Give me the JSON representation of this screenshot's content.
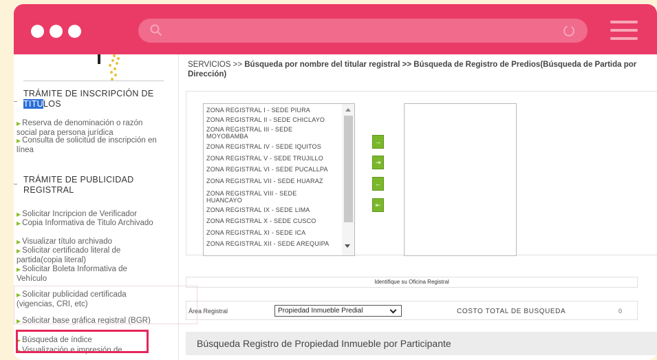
{
  "sidebar": {
    "section1_title_a": "TRÁMITE DE INSCRIPCIÓN DE",
    "section1_title_highlight": "TITU",
    "section1_title_rest": "LOS",
    "section1_links": [
      "Reserva de denominación o razón social para persona jurídica",
      "Consulta de solicitud de inscripción en línea"
    ],
    "section2_title": "TRÁMITE DE PUBLICIDAD REGISTRAL",
    "section2_links": [
      "Solicitar Incripcion de Verificador",
      "Copia Informativa de Titulo Archivado",
      "Visualizar título archivado",
      "Solicitar certificado literal de partida(copia literal)",
      "Solicitar Boleta Informativa de Vehículo",
      "Solicitar publicidad certificada (vigencias, CRI, etc)",
      "Solicitar base gráfica registral (BGR)",
      "Búsqueda de índice",
      "Visualización e impresión de"
    ]
  },
  "breadcrumb": {
    "prefix": "SERVICIOS >> ",
    "bold": "Búsqueda por nombre del titular registral >> Búsqueda de Registro de Predios(Búsqueda de Partida por Dirección)"
  },
  "zones": [
    "ZONA REGISTRAL I - SEDE PIURA",
    "ZONA REGISTRAL II - SEDE CHICLAYO",
    "ZONA REGISTRAL III - SEDE MOYOBAMBA",
    "ZONA REGISTRAL IV - SEDE IQUITOS",
    "ZONA REGISTRAL V - SEDE TRUJILLO",
    "ZONA REGISTRAL VI - SEDE PUCALLPA",
    "ZONA REGISTRAL VII - SEDE HUARAZ",
    "ZONA REGISTRAL VIII - SEDE HUANCAYO",
    "ZONA REGISTRAL IX - SEDE LIMA",
    "ZONA REGISTRAL X - SEDE CUSCO",
    "ZONA REGISTRAL XI - SEDE ICA",
    "ZONA REGISTRAL XII - SEDE AREQUIPA"
  ],
  "move_buttons": [
    "→",
    "⇥",
    "←",
    "⇤"
  ],
  "office_label": "Identifique su Oficina Registral",
  "area": {
    "label": "Área Registral",
    "selected": "Propiedad Inmueble Predial",
    "cost_label": "COSTO TOTAL DE BUSQUEDA",
    "cost_value": "0"
  },
  "bottom_heading": "Búsqueda Registro de Propiedad Inmueble por Participante",
  "colors": {
    "titlebar": "#ea3b66",
    "background": "#fdf3d9",
    "button_green": "#7ab82a",
    "highlight_box": "#e5265a"
  },
  "icons": {
    "window_controls": "three-dots",
    "search": "search-icon",
    "reload": "reload-icon",
    "menu": "hamburger-icon"
  }
}
